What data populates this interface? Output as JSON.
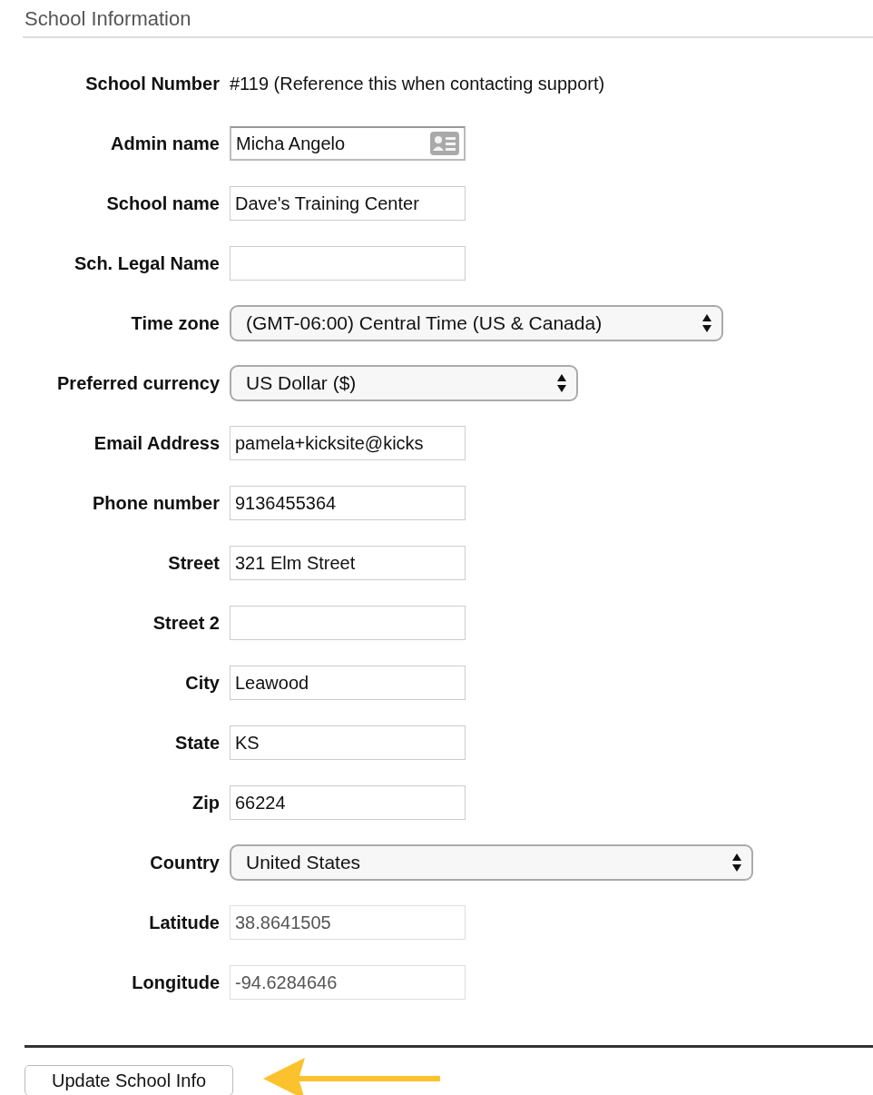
{
  "section_title": "School Information",
  "fields": [
    {
      "kind": "static",
      "label": "School Number",
      "value": "#119 (Reference this when contacting support)"
    },
    {
      "kind": "contact",
      "label": "Admin name",
      "value": "Micha Angelo"
    },
    {
      "kind": "text",
      "label": "School name",
      "value": "Dave's Training Center"
    },
    {
      "kind": "text",
      "label": "Sch. Legal Name"
    },
    {
      "kind": "select",
      "label": "Time zone",
      "value": "(GMT-06:00) Central Time (US & Canada)"
    },
    {
      "kind": "select",
      "label": "Preferred currency",
      "value": "US Dollar ($)"
    },
    {
      "kind": "text",
      "label": "Email Address",
      "value": "pamela+kicksite@kicks"
    },
    {
      "kind": "text",
      "label": "Phone number",
      "value": "9136455364"
    },
    {
      "kind": "text",
      "label": "Street",
      "value": "321 Elm Street"
    },
    {
      "kind": "text",
      "label": "Street 2"
    },
    {
      "kind": "text",
      "label": "City",
      "value": "Leawood"
    },
    {
      "kind": "text",
      "label": "State",
      "value": "KS"
    },
    {
      "kind": "text",
      "label": "Zip",
      "value": "66224"
    },
    {
      "kind": "select",
      "label": "Country",
      "value": "United States"
    },
    {
      "kind": "readonly",
      "label": "Latitude",
      "value": "38.8641505"
    },
    {
      "kind": "readonly",
      "label": "Longitude",
      "value": "-94.6284646"
    }
  ],
  "submit_button": "Update School Info"
}
